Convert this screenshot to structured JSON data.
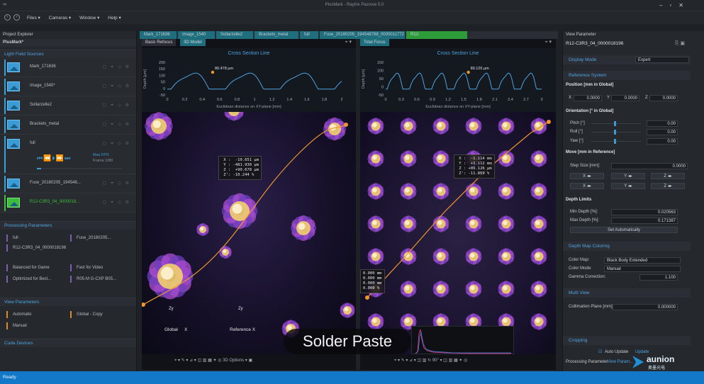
{
  "window": {
    "title": "PlusMark - Raytrix Pasrove 5.0"
  },
  "menu": [
    "Files ▾",
    "Cameras ▾",
    "Window ▾",
    "Help ▾"
  ],
  "left_panel": {
    "explorer_title": "Project Explorer",
    "project_name": "PlusMark*",
    "lightfield_title": "Light Field Sources",
    "sources": [
      "Mark_171636",
      "Image_1540*",
      "Sollarzelle2",
      "Brackets_metal",
      "full",
      "Fuse_20180205_194548...",
      "R12-C3R3_04_0000018..."
    ],
    "player": {
      "fps": "Max FPS",
      "frame": "Frame 1/80"
    },
    "processing_title": "Processing Parameters",
    "processing": [
      "full",
      "Fuse_20180205...",
      "R12-C3R3_04_0000018196",
      "Balanced for Game",
      "Fast for Video",
      "Optimized for Best...",
      "R05-M G-CXP B05..."
    ],
    "view_params_title": "View Parameters",
    "view_params": [
      "Automatic",
      "Global - Copy",
      "Manual"
    ],
    "devices_title": "Cuda Devices"
  },
  "doc_tabs": [
    "Mark_171636",
    "Image_1540",
    "Sollarzelle2",
    "Brackets_metal",
    "full",
    "Fuse_20180205_194548788_0000011772",
    "R12-C3R3_04_0000018196"
  ],
  "views": {
    "left": {
      "tabs": [
        "Basic Refocus",
        "3D Model"
      ],
      "cross_title": "Cross Section Line",
      "y_axis": "Depth [µm]",
      "x_axis": "Euclidean distance on XY-plane [mm]",
      "y_ticks": [
        "200",
        "150",
        "100",
        "50",
        "0",
        "-50"
      ],
      "x_ticks": [
        "0",
        "0.2",
        "0.4",
        "0.6",
        "0.8",
        "1",
        "1.2",
        "1.4",
        "1.6",
        "1.8",
        "2"
      ],
      "marker_label": "80.478 µm",
      "readout": " X :  -10.651 µm\n Y : -481.930 µm\n Z :  +90.678 µm\n Z': -10.244 %",
      "axis_labels": {
        "global": "Global",
        "ref": "Reference X",
        "zy": "Zy",
        "x": "X"
      }
    },
    "right": {
      "tabs": [
        "Total Focus"
      ],
      "cross_title": "Cross Section Line",
      "y_axis": "Depth [µm]",
      "x_axis": "Euclidean distance on XY-plane [mm]",
      "y_ticks": [
        "150",
        "100",
        "50",
        "0",
        "-50"
      ],
      "x_ticks": [
        "0",
        "0.3",
        "0.6",
        "0.9",
        "1.2",
        "1.5",
        "1.8",
        "2.1",
        "2.4",
        "2.7",
        "3"
      ],
      "marker_label": "89.126 µm",
      "readout": " X :  -1.114 mm\n Y :  +1.112 mm\n Z : +89.126 µm\n Z': -11.869 %",
      "readout2": "0.000 mm\n0.000 mm\n0.000 mm\n0.000 %"
    }
  },
  "bottom_toolbars": {
    "left_options": "3D Options ▾",
    "right_zoom": "90° ▾"
  },
  "caption": "Solder Paste",
  "right_panel": {
    "title": "View Parameter",
    "name": "R12-C3R3_04_0000018196",
    "display_mode_label": "Display Mode",
    "display_mode_value": "Expert",
    "ref_system": "Reference System",
    "position_label": "Position [mm in Global]",
    "pos_x": "0.0000",
    "pos_y": "0.0000",
    "pos_z": "0.0000",
    "orientation_label": "Orientation [° in Global]",
    "pitch": "0.00",
    "roll": "0.00",
    "yaw": "0.00",
    "pitch_label": "Pitch [°]",
    "roll_label": "Roll [°]",
    "yaw_label": "Yaw [°]",
    "move_label": "Move [mm in Reference]",
    "step_label": "Step Size [mm]:",
    "step_value": "0.0000",
    "depth_limits": "Depth Limits",
    "min_depth_label": "Min Depth [%]:",
    "min_depth": "0.020563",
    "max_depth_label": "Max Depth [%]:",
    "max_depth": "0.171387",
    "set_auto": "Set Automatically",
    "depth_coloring": "Depth Map Coloring",
    "color_map_label": "Color Map:",
    "color_map": "Black Body Extended",
    "color_mode_label": "Color Mode:",
    "color_mode": "Manual",
    "gamma_label": "Gamma Correction:",
    "gamma": "1.100",
    "multi_view": "Multi View",
    "collimation_label": "Collimation Plane [mm]:",
    "collimation": "0.000000",
    "cropping": "Cropping",
    "auto_update": "Auto Update",
    "update": "Update",
    "footer_tabs": [
      "Processing Parameter",
      "View Param..."
    ]
  },
  "status": "Ready",
  "logo": {
    "name": "aunion",
    "sub": "奥墨光电"
  },
  "accent": "#4fa3e0",
  "status_color": "#1478c9"
}
